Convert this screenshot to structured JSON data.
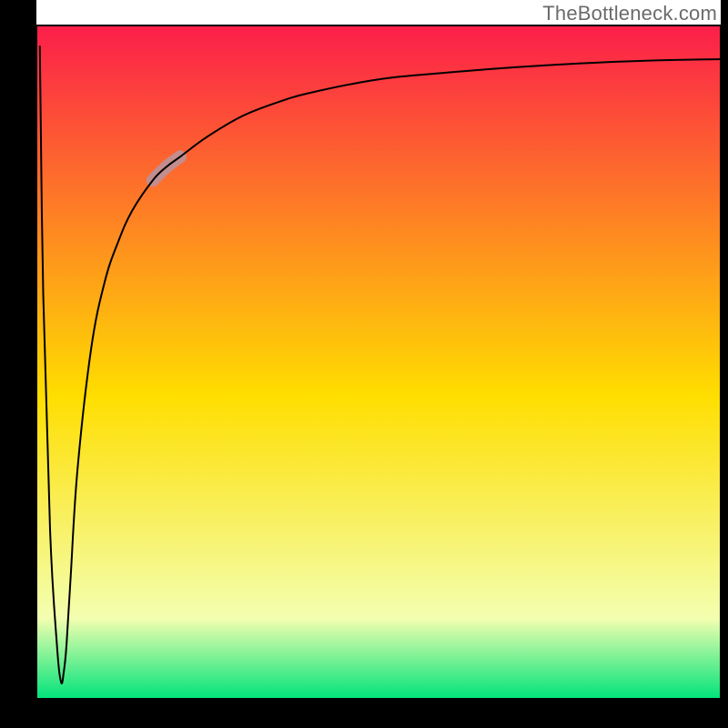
{
  "watermark": "TheBottleneck.com",
  "chart_data": {
    "type": "line",
    "title": "",
    "xlabel": "",
    "ylabel": "",
    "xlim": [
      0,
      100
    ],
    "ylim": [
      0,
      100
    ],
    "grid": false,
    "background_gradient": {
      "top": "#fc1e4a",
      "mid": "#ffde00",
      "bottom": "#00e37a"
    },
    "plot_border": "#000000",
    "series": [
      {
        "name": "bottleneck-curve",
        "color": "#000000",
        "stroke_width": 2,
        "x": [
          0.5,
          1.0,
          2.0,
          3.0,
          3.6,
          4.0,
          4.4,
          5.0,
          6.0,
          8.0,
          10.0,
          12.0,
          14.0,
          17.0,
          19.0,
          21.0,
          25.0,
          30.0,
          35.0,
          40.0,
          50.0,
          60.0,
          70.0,
          80.0,
          90.0,
          100.0
        ],
        "y": [
          97.0,
          60.0,
          25.0,
          8.0,
          2.5,
          4.0,
          8.0,
          18.0,
          34.0,
          52.0,
          62.0,
          68.0,
          72.5,
          77.0,
          79.0,
          80.5,
          83.5,
          86.5,
          88.5,
          90.0,
          92.0,
          93.0,
          93.8,
          94.4,
          94.8,
          95.0
        ]
      },
      {
        "name": "highlight-segment",
        "color": "#c38d8d",
        "stroke_width": 14,
        "linecap": "round",
        "x": [
          17.0,
          19.0,
          21.0
        ],
        "y": [
          77.0,
          79.0,
          80.5
        ]
      }
    ]
  }
}
